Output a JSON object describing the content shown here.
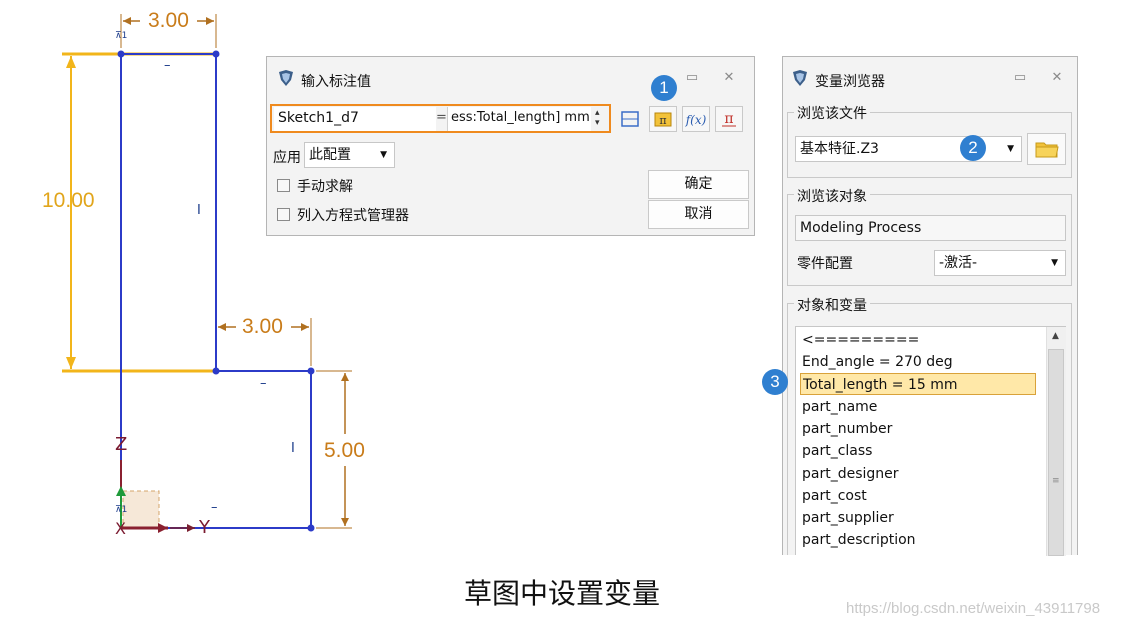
{
  "sketch": {
    "dims": {
      "top_width": "3.00",
      "mid_width": "3.00",
      "height_left": "10.00",
      "height_right": "5.00"
    },
    "axis": {
      "z": "Z",
      "y": "Y",
      "x": "X"
    },
    "colors": {
      "dimension": "#c97c1a",
      "geometry": "#2c3bc8",
      "highlight": "#f2b51a"
    }
  },
  "dialog_dim": {
    "title": "输入标注值",
    "name_value": "Sketch1_d7",
    "eq_sign": "=",
    "expr_value": "ess:Total_length] mm",
    "apply_label": "应用",
    "apply_value": "此配置",
    "manual_solve": "手动求解",
    "add_to_eq_mgr": "列入方程式管理器",
    "ok": "确定",
    "cancel": "取消",
    "badge": "1"
  },
  "var_browser": {
    "title": "变量浏览器",
    "browse_file_label": "浏览该文件",
    "file_value": "基本特征.Z3",
    "badge_file": "2",
    "browse_object_label": "浏览该对象",
    "object_value": "Modeling Process",
    "part_config_label": "零件配置",
    "part_config_value": "-激活-",
    "objects_vars_label": "对象和变量",
    "badge_list": "3",
    "items": [
      "<=========",
      "End_angle = 270 deg",
      "Total_length = 15 mm",
      "part_name",
      "part_number",
      "part_class",
      "part_designer",
      "part_cost",
      "part_supplier",
      "part_description"
    ],
    "selected_index": 2
  },
  "caption": "草图中设置变量",
  "watermark": "https://blog.csdn.net/weixin_43911798"
}
